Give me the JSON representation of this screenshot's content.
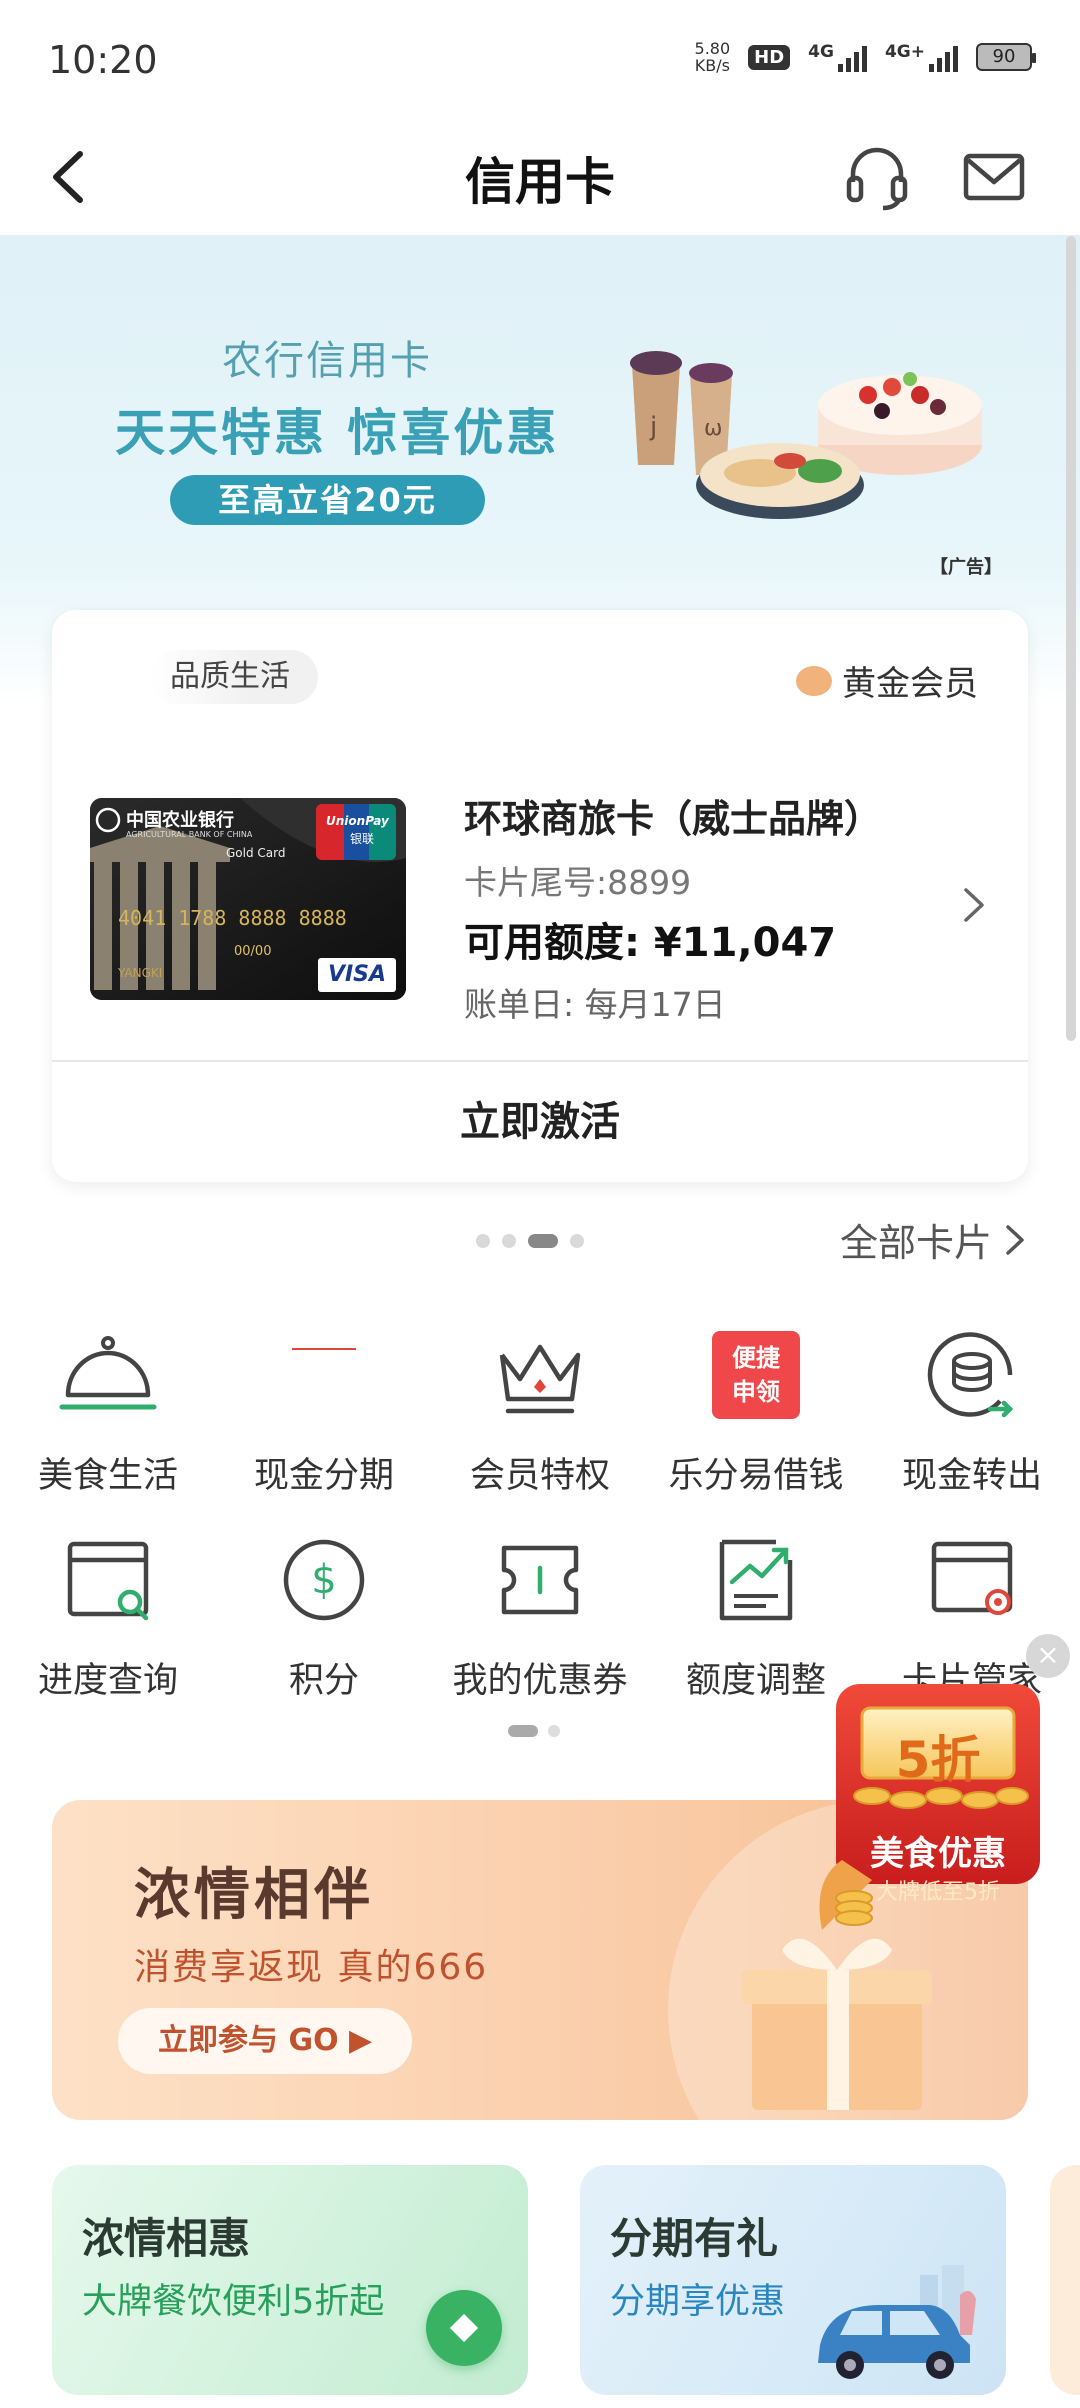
{
  "status": {
    "time": "10:20",
    "speed_value": "5.80",
    "speed_unit": "KB/s",
    "hd": "HD",
    "net1": "4G",
    "net2": "4G+",
    "battery": "90"
  },
  "header": {
    "title": "信用卡"
  },
  "banner": {
    "small_text": "农行信用卡",
    "main_text": "天天特惠 惊喜优惠",
    "pill_text": "至高立省20元",
    "ad_label": "【广告】"
  },
  "card_panel": {
    "tag": "品质生活",
    "member_level": "黄金会员",
    "card_image": {
      "bank_name_cn": "中国农业银行",
      "bank_name_en": "AGRICULTURAL BANK OF CHINA",
      "grade": "Gold Card",
      "number": "4041 1788 8888 8888",
      "valid_thru": "00/00",
      "holder": "YANGKI",
      "unionpay": "UnionPay",
      "unionpay_cn": "银联",
      "visa": "VISA"
    },
    "card_name": "环球商旅卡（威士品牌）",
    "card_tail": "卡片尾号:8899",
    "card_limit": "可用额度: ¥11,047",
    "bill_day": "账单日: 每月17日",
    "activate_label": "立即激活"
  },
  "pager": {
    "all_cards": "全部卡片"
  },
  "grid": {
    "items": [
      {
        "label": "美食生活",
        "icon": "cloche-icon"
      },
      {
        "label": "现金分期",
        "icon": "installment-icon"
      },
      {
        "label": "会员特权",
        "icon": "crown-icon"
      },
      {
        "label": "乐分易借钱",
        "icon": "loan-badge-icon",
        "badge_line1": "便捷",
        "badge_line2": "申领"
      },
      {
        "label": "现金转出",
        "icon": "coin-transfer-icon"
      },
      {
        "label": "进度查询",
        "icon": "progress-search-icon"
      },
      {
        "label": "积分",
        "icon": "dollar-points-icon"
      },
      {
        "label": "我的优惠券",
        "icon": "coupon-icon"
      },
      {
        "label": "额度调整",
        "icon": "chart-adjust-icon"
      },
      {
        "label": "卡片管家",
        "icon": "card-settings-icon"
      }
    ]
  },
  "promo": {
    "title": "浓情相伴",
    "subtitle": "消费享返现 真的666",
    "button": "立即参与 GO ▶"
  },
  "float_ad": {
    "discount": "5折",
    "title": "美食优惠",
    "subtitle": "大牌低至5折"
  },
  "mini_cards": [
    {
      "title": "浓情相惠",
      "subtitle": "大牌餐饮便利5折起"
    },
    {
      "title": "分期有礼",
      "subtitle": "分期享优惠"
    }
  ],
  "colors": {
    "accent_green": "#2fae6e",
    "banner_blue": "#3aa0b6",
    "promo_orange": "#c0532e",
    "badge_red": "#f0474a"
  }
}
